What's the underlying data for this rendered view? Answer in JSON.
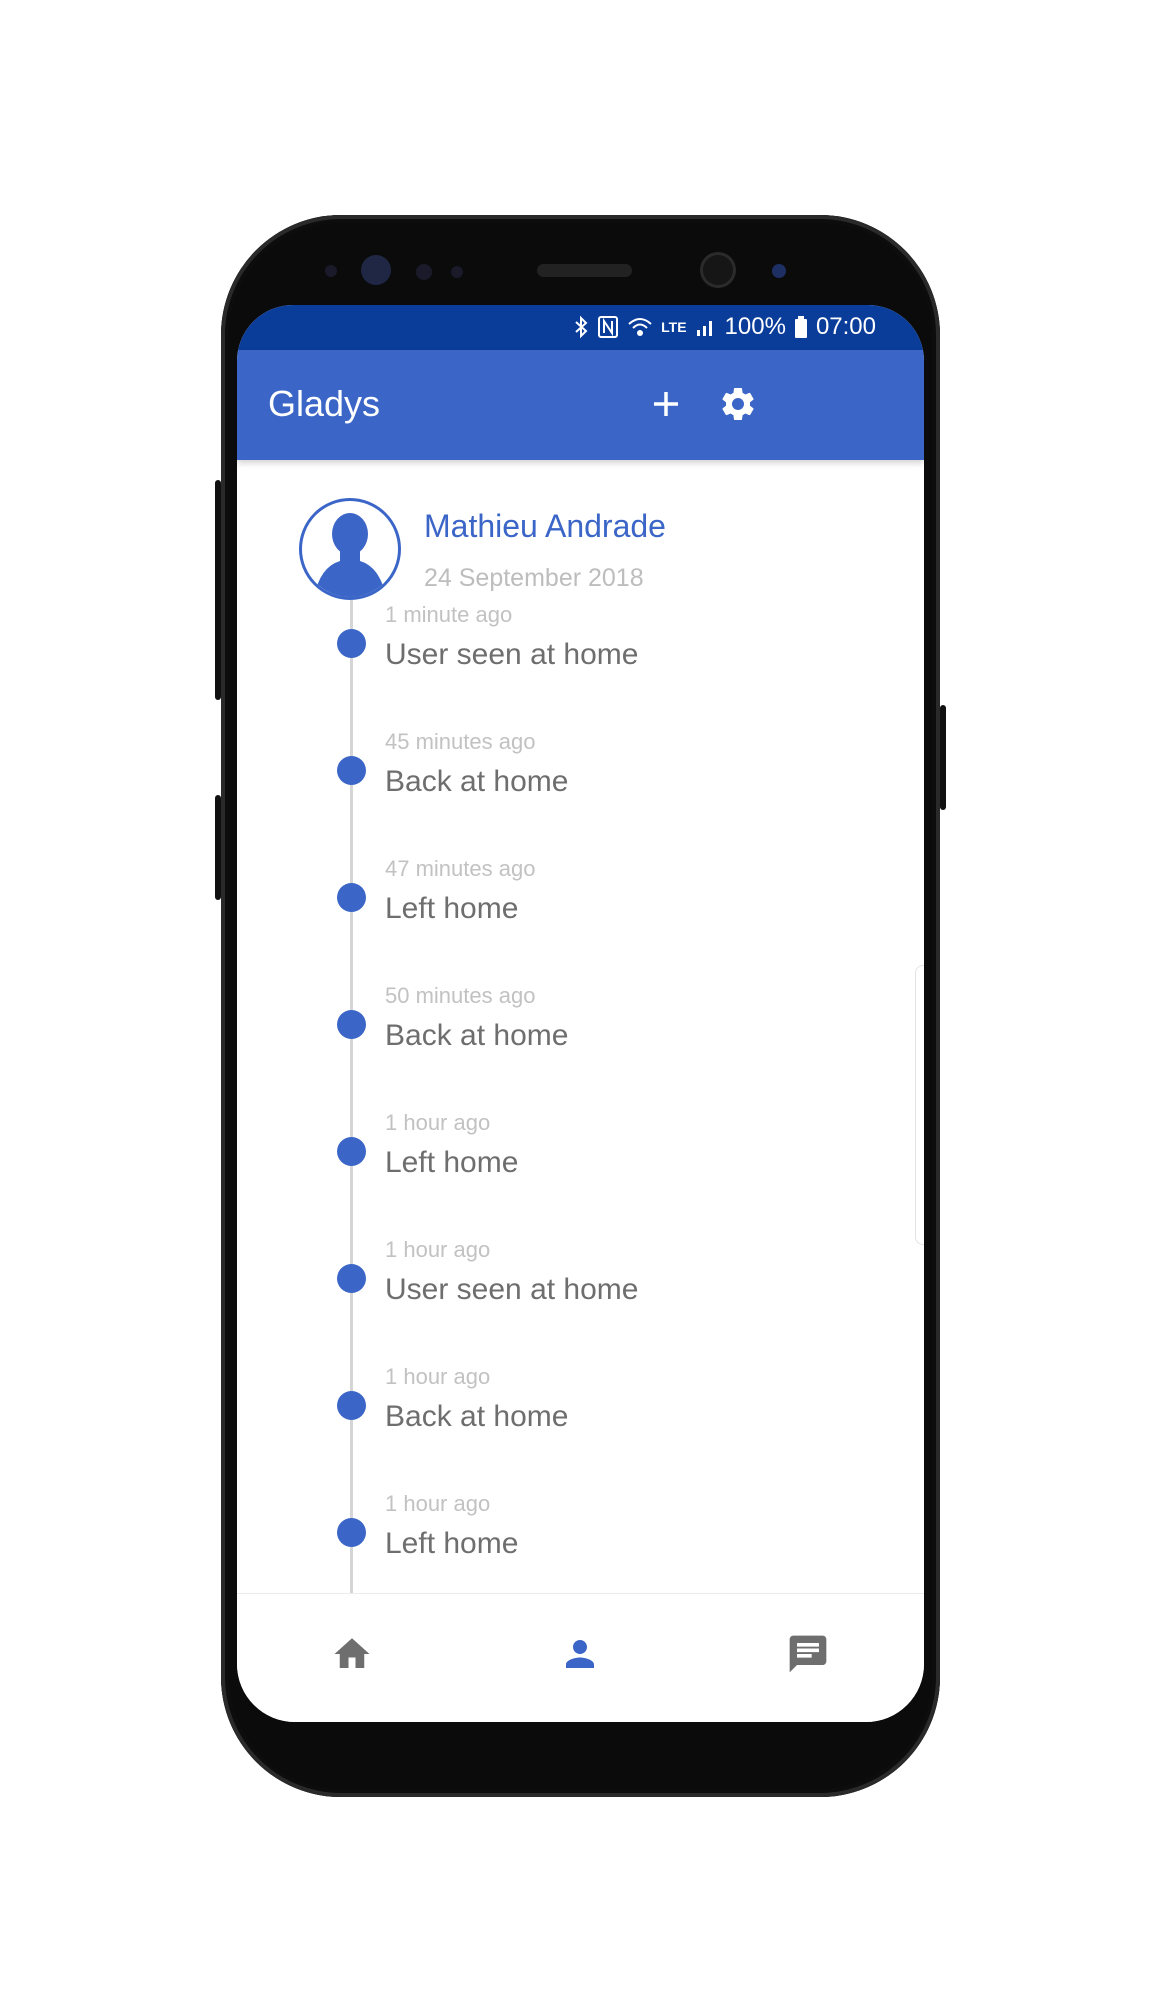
{
  "status_bar": {
    "battery": "100%",
    "time": "07:00",
    "network": "LTE",
    "icons": [
      "bluetooth-icon",
      "nfc-icon",
      "wifi-icon",
      "signal-icon",
      "battery-icon"
    ]
  },
  "app_bar": {
    "title": "Gladys",
    "actions": [
      "add-icon",
      "settings-icon"
    ]
  },
  "profile": {
    "name": "Mathieu Andrade",
    "date": "24 September 2018"
  },
  "timeline": [
    {
      "time": "1 minute ago",
      "label": "User seen at home"
    },
    {
      "time": "45 minutes ago",
      "label": "Back at home"
    },
    {
      "time": "47 minutes ago",
      "label": "Left home"
    },
    {
      "time": "50 minutes ago",
      "label": "Back at home"
    },
    {
      "time": "1 hour ago",
      "label": "Left home"
    },
    {
      "time": "1 hour ago",
      "label": "User seen at home"
    },
    {
      "time": "1 hour ago",
      "label": "Back at home"
    },
    {
      "time": "1 hour ago",
      "label": "Left home"
    }
  ],
  "bottom_nav": {
    "items": [
      "home-icon",
      "person-icon",
      "chat-icon"
    ],
    "active": "person-icon"
  },
  "colors": {
    "primary": "#3b66c8",
    "status_bar": "#0a3d9a",
    "text_secondary": "#6e6e6e",
    "text_muted": "#c2c2c2"
  }
}
